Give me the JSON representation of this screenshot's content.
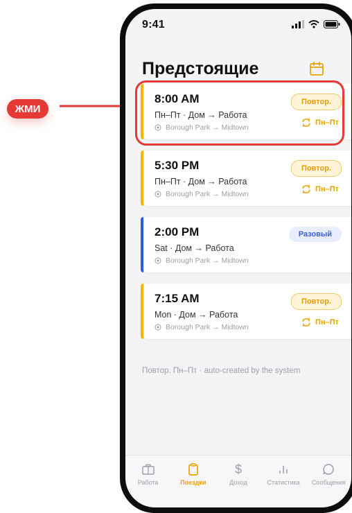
{
  "annotation": {
    "hint_label": "ЖМИ"
  },
  "status_bar": {
    "time": "9:41"
  },
  "header": {
    "title": "Предстоящие"
  },
  "trips": [
    {
      "time": "8:00 AM",
      "route": "Пн–Пт · Дом → Работа",
      "location": "Borough Park → Midtown",
      "badge": "Повтор.",
      "badge_type": "repeat",
      "recurrence": "Пн–Пт",
      "stripe_color": "#f5b400"
    },
    {
      "time": "5:30 PM",
      "route": "Пн–Пт · Дом → Работа",
      "location": "Borough Park → Midtown",
      "badge": "Повтор.",
      "badge_type": "repeat",
      "recurrence": "Пн–Пт",
      "stripe_color": "#f5b400"
    },
    {
      "time": "2:00 PM",
      "route": "Sat · Дом → Работа",
      "location": "Borough Park → Midtown",
      "badge": "Разовый",
      "badge_type": "once",
      "recurrence": "",
      "stripe_color": "#2d5be3"
    },
    {
      "time": "7:15 AM",
      "route": "Mon · Дом → Работа",
      "location": "Borough Park → Midtown",
      "badge": "Повтор.",
      "badge_type": "repeat",
      "recurrence": "Пн–Пт",
      "stripe_color": "#f5b400"
    }
  ],
  "footnote": "Повтор. Пн–Пт · auto-created by the system",
  "tabs": [
    {
      "label": "Работа",
      "icon": "briefcase-icon",
      "active": false
    },
    {
      "label": "Поездки",
      "icon": "clipboard-icon",
      "active": true
    },
    {
      "label": "Доход",
      "icon": "dollar-icon",
      "active": false
    },
    {
      "label": "Статистика",
      "icon": "bar-chart-icon",
      "active": false
    },
    {
      "label": "Сообщения",
      "icon": "chat-bubble-icon",
      "active": false
    }
  ],
  "colors": {
    "accent": "#e6a300",
    "highlight": "#e53935",
    "once": "#2d5be3"
  }
}
